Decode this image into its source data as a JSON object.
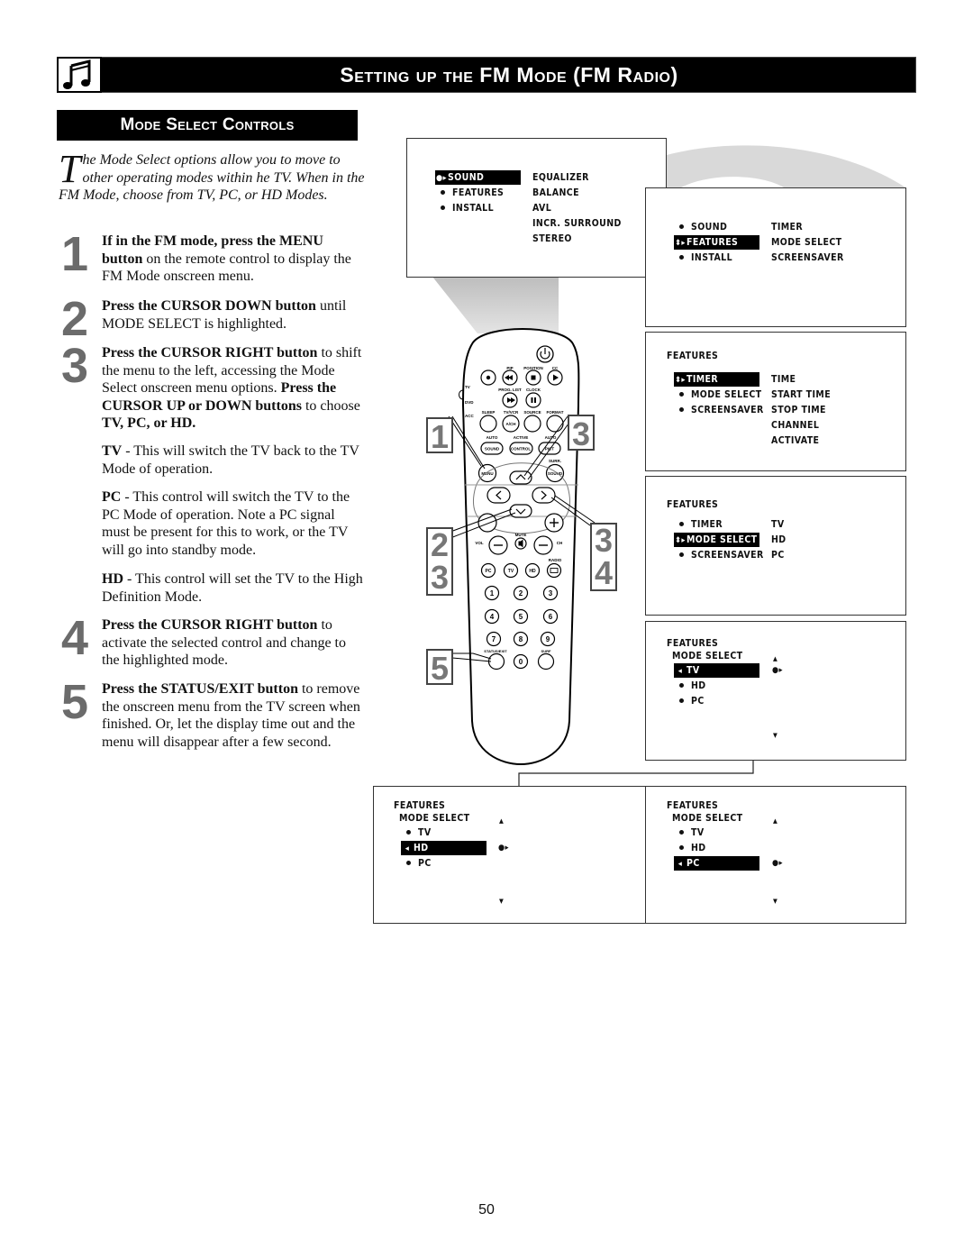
{
  "header": {
    "title": "Setting up the FM Mode (FM Radio)",
    "icon": "music-note-icon"
  },
  "section": {
    "title": "Mode Select Controls"
  },
  "intro": {
    "dropcap": "T",
    "text": "he Mode Select options allow you to move to other operating modes within he TV. When in the FM Mode, choose from TV, PC, or HD Modes."
  },
  "steps": [
    {
      "num": "1",
      "bold": "If in the FM mode, press the MENU button",
      "text": " on the remote control to display the FM Mode onscreen menu."
    },
    {
      "num": "2",
      "bold": "Press the CURSOR DOWN button",
      "text": " until MODE SELECT is highlighted."
    },
    {
      "num": "3",
      "bold": "Press the CURSOR RIGHT button",
      "text": " to shift the menu to the left, accessing the Mode Select onscreen menu options. ",
      "bold2": "Press the CURSOR UP or DOWN buttons",
      "text2": " to choose ",
      "bold3": "TV, PC, or HD."
    },
    {
      "num": "4",
      "bold": "Press the CURSOR RIGHT button",
      "text": " to activate the selected control and change to the highlighted mode."
    },
    {
      "num": "5",
      "bold": "Press the STATUS/EXIT button",
      "text": " to remove the onscreen menu from the TV screen when finished. Or, let the display time out and the menu will disappear after a few second."
    }
  ],
  "options": [
    {
      "name": "TV",
      "text": " - This will switch the TV back to the TV Mode of operation."
    },
    {
      "name": "PC",
      "text": " - This control will switch the TV to the PC Mode of operation. Note a PC signal must be present for this to work, or the TV will go into standby mode."
    },
    {
      "name": "HD",
      "text": " - This control will set the TV to the High Definition Mode."
    }
  ],
  "screens": {
    "main_menu": {
      "left": [
        "SOUND",
        "FEATURES",
        "INSTALL"
      ],
      "selected": 0,
      "right": [
        "EQUALIZER",
        "BALANCE",
        "AVL",
        "INCR. SURROUND",
        "STEREO"
      ]
    },
    "features_highlight": {
      "left": [
        "SOUND",
        "FEATURES",
        "INSTALL"
      ],
      "selected": 1,
      "right": [
        "TIMER",
        "MODE SELECT",
        "SCREENSAVER"
      ]
    },
    "features_timer": {
      "title": "FEATURES",
      "left": [
        "TIMER",
        "MODE SELECT",
        "SCREENSAVER"
      ],
      "selected": 0,
      "right": [
        "TIME",
        "START TIME",
        "STOP TIME",
        "CHANNEL",
        "ACTIVATE"
      ]
    },
    "features_mode_select": {
      "title": "FEATURES",
      "left": [
        "TIMER",
        "MODE SELECT",
        "SCREENSAVER"
      ],
      "selected": 1,
      "right": [
        "TV",
        "HD",
        "PC"
      ]
    },
    "mode_select_tv": {
      "title": "FEATURES",
      "subtitle": "MODE SELECT",
      "items": [
        "TV",
        "HD",
        "PC"
      ],
      "selected": 0
    },
    "mode_select_hd": {
      "title": "FEATURES",
      "subtitle": "MODE SELECT",
      "items": [
        "TV",
        "HD",
        "PC"
      ],
      "selected": 1
    },
    "mode_select_pc": {
      "title": "FEATURES",
      "subtitle": "MODE SELECT",
      "items": [
        "TV",
        "HD",
        "PC"
      ],
      "selected": 2
    }
  },
  "remote": {
    "labels": {
      "pip": "PIP",
      "position": "POSITION",
      "cc": "CC",
      "prog_list": "PROG. LIST",
      "clock": "CLOCK",
      "tv": "TV",
      "dvd": "DVD",
      "acc": "ACC",
      "sleep": "SLEEP",
      "tvvcr": "TV/VCR",
      "source": "SOURCE",
      "format": "FORMAT",
      "ach": "A/CH",
      "auto1": "AUTO",
      "active": "ACTIVE",
      "auto2": "AUTO",
      "sound": "SOUND",
      "control": "CONTROL",
      "picture": "PICT",
      "menu": "MENU",
      "surr": "SURR.",
      "sound2": "SOUND",
      "vol": "VOL",
      "mute": "MUTE",
      "ch": "CH",
      "radio": "RADIO",
      "pc": "PC",
      "tvbtn": "TV",
      "hd": "HD",
      "status_exit": "STATUS/EXIT",
      "surf": "SURF"
    },
    "digits": [
      "1",
      "2",
      "3",
      "4",
      "5",
      "6",
      "7",
      "8",
      "9",
      "0"
    ],
    "callouts": {
      "c1": "1",
      "c3a": "3",
      "c23": [
        "2",
        "3"
      ],
      "c34": [
        "3",
        "4"
      ],
      "c5": "5"
    }
  },
  "page_number": "50"
}
